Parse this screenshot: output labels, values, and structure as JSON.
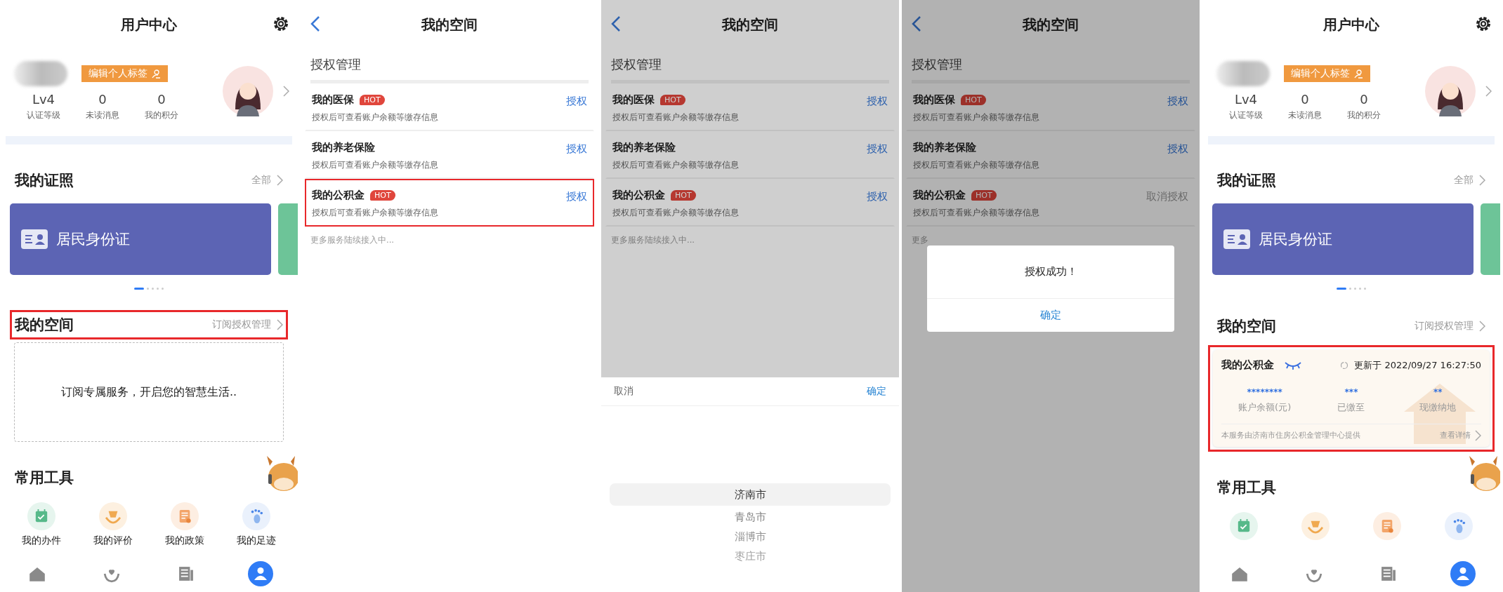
{
  "screens": [
    {
      "kind": "user_center",
      "title": "用户中心",
      "profile": {
        "tag_button": "编辑个人标签",
        "stats": [
          {
            "value": "Lv4",
            "label": "认证等级"
          },
          {
            "value": "0",
            "label": "未读消息"
          },
          {
            "value": "0",
            "label": "我的积分"
          }
        ]
      },
      "certificates": {
        "title": "我的证照",
        "more": "全部",
        "cards": [
          {
            "label": "居民身份证",
            "color": "#5c64b4"
          },
          {
            "color": "#6dc498"
          }
        ],
        "pages": [
          {
            "selected": true
          },
          {
            "selected": false
          },
          {
            "selected": false
          },
          {
            "selected": false
          },
          {
            "selected": false
          }
        ]
      },
      "space": {
        "title": "我的空间",
        "more": "订阅授权管理",
        "highlighted": true,
        "empty_text": "订阅专属服务，开启您的智慧生活.."
      },
      "tools": {
        "title": "常用工具",
        "items": [
          {
            "kind": "calendar",
            "label": "我的办件"
          },
          {
            "kind": "rating",
            "label": "我的评价"
          },
          {
            "kind": "policy",
            "label": "我的政策"
          },
          {
            "kind": "footprint",
            "label": "我的足迹"
          }
        ]
      },
      "nav": [
        {
          "kind": "home",
          "selected": false
        },
        {
          "kind": "service",
          "selected": false
        },
        {
          "kind": "news",
          "selected": false
        },
        {
          "kind": "user",
          "selected": true
        }
      ]
    },
    {
      "kind": "authorization",
      "title": "我的空间",
      "section": "授权管理",
      "items": [
        {
          "name": "我的医保",
          "badge": "HOT",
          "desc": "授权后可查看账户余额等缴存信息",
          "action": "授权",
          "granted": false,
          "highlighted": false
        },
        {
          "name": "我的养老保险",
          "desc": "授权后可查看账户余额等缴存信息",
          "action": "授权",
          "granted": false,
          "highlighted": false
        },
        {
          "name": "我的公积金",
          "badge": "HOT",
          "desc": "授权后可查看账户余额等缴存信息",
          "action": "授权",
          "granted": false,
          "highlighted": true
        }
      ],
      "footer": "更多服务陆续接入中...",
      "dimmed": false
    },
    {
      "kind": "authorization",
      "title": "我的空间",
      "section": "授权管理",
      "items": [
        {
          "name": "我的医保",
          "badge": "HOT",
          "desc": "授权后可查看账户余额等缴存信息",
          "action": "授权",
          "granted": false,
          "highlighted": false
        },
        {
          "name": "我的养老保险",
          "desc": "授权后可查看账户余额等缴存信息",
          "action": "授权",
          "granted": false,
          "highlighted": false
        },
        {
          "name": "我的公积金",
          "badge": "HOT",
          "desc": "授权后可查看账户余额等缴存信息",
          "action": "授权",
          "granted": false,
          "highlighted": false
        }
      ],
      "footer": "更多服务陆续接入中...",
      "dimmed": true,
      "picker": {
        "cancel": "取消",
        "confirm": "确定",
        "options": [
          {
            "label": "济南市",
            "selected": true
          },
          {
            "label": "青岛市",
            "selected": false
          },
          {
            "label": "淄博市",
            "selected": false
          },
          {
            "label": "枣庄市",
            "selected": false
          }
        ]
      }
    },
    {
      "kind": "authorization",
      "title": "我的空间",
      "section": "授权管理",
      "items": [
        {
          "name": "我的医保",
          "badge": "HOT",
          "desc": "授权后可查看账户余额等缴存信息",
          "action": "授权",
          "granted": false,
          "highlighted": false
        },
        {
          "name": "我的养老保险",
          "desc": "授权后可查看账户余额等缴存信息",
          "action": "授权",
          "granted": false,
          "highlighted": false
        },
        {
          "name": "我的公积金",
          "badge": "HOT",
          "desc": "授权后可查看账户余额等缴存信息",
          "action": "取消授权",
          "granted": true,
          "highlighted": false
        }
      ],
      "footer": "更多",
      "dimmed": true,
      "dialog": {
        "message": "授权成功！",
        "button": "确定"
      }
    },
    {
      "kind": "user_center",
      "title": "用户中心",
      "profile": {
        "tag_button": "编辑个人标签",
        "stats": [
          {
            "value": "Lv4",
            "label": "认证等级"
          },
          {
            "value": "0",
            "label": "未读消息"
          },
          {
            "value": "0",
            "label": "我的积分"
          }
        ]
      },
      "certificates": {
        "title": "我的证照",
        "more": "全部",
        "cards": [
          {
            "label": "居民身份证",
            "color": "#5c64b4"
          },
          {
            "color": "#6dc498"
          }
        ],
        "pages": [
          {
            "selected": true
          },
          {
            "selected": false
          },
          {
            "selected": false
          },
          {
            "selected": false
          },
          {
            "selected": false
          }
        ]
      },
      "space": {
        "title": "我的空间",
        "more": "订阅授权管理",
        "highlighted": false,
        "fund_card": {
          "title": "我的公积金",
          "updated": "更新于 2022/09/27 16:27:50",
          "highlighted": true,
          "stats": [
            {
              "value": "********",
              "label": "账户余额(元)"
            },
            {
              "value": "***",
              "label": "已缴至"
            },
            {
              "value": "**",
              "label": "现缴纳地"
            }
          ],
          "provider": "本服务由济南市住房公积金管理中心提供",
          "link": "查看详情"
        }
      },
      "tools": {
        "title": "常用工具",
        "items": [
          {
            "kind": "calendar"
          },
          {
            "kind": "rating"
          },
          {
            "kind": "policy"
          },
          {
            "kind": "footprint"
          }
        ]
      },
      "nav": [
        {
          "kind": "home",
          "selected": false
        },
        {
          "kind": "service",
          "selected": false
        },
        {
          "kind": "news",
          "selected": false
        },
        {
          "kind": "user",
          "selected": true
        }
      ]
    }
  ]
}
